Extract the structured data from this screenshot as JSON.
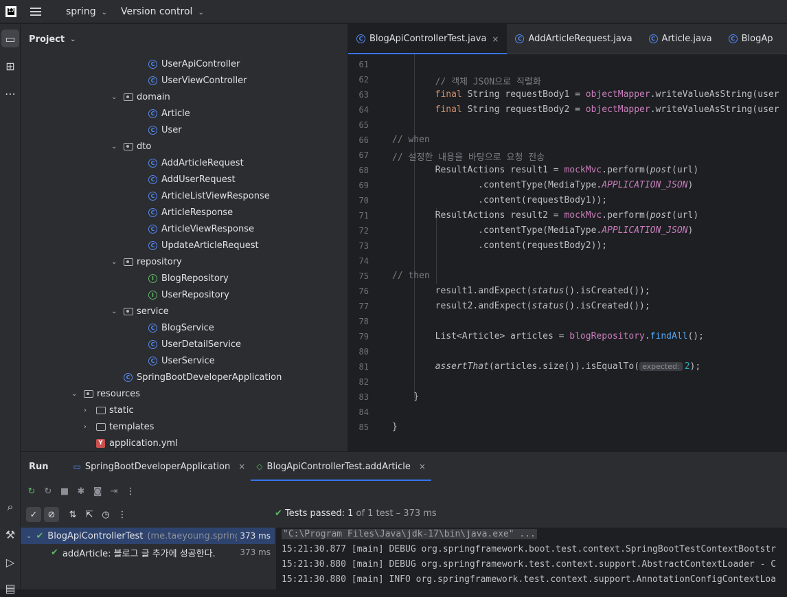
{
  "topbar": {
    "project": "spring",
    "vcs": "Version control"
  },
  "project_panel": {
    "title": "Project",
    "rows": [
      {
        "label": "UserApiController",
        "icon": "class",
        "depth": 3
      },
      {
        "label": "UserViewController",
        "icon": "class",
        "depth": 3
      },
      {
        "label": "domain",
        "icon": "package",
        "depth": 2,
        "expanded": true
      },
      {
        "label": "Article",
        "icon": "class",
        "depth": 3
      },
      {
        "label": "User",
        "icon": "class",
        "depth": 3
      },
      {
        "label": "dto",
        "icon": "package",
        "depth": 2,
        "expanded": true
      },
      {
        "label": "AddArticleRequest",
        "icon": "class",
        "depth": 3
      },
      {
        "label": "AddUserRequest",
        "icon": "class",
        "depth": 3
      },
      {
        "label": "ArticleListViewResponse",
        "icon": "class",
        "depth": 3
      },
      {
        "label": "ArticleResponse",
        "icon": "class",
        "depth": 3
      },
      {
        "label": "ArticleViewResponse",
        "icon": "class",
        "depth": 3
      },
      {
        "label": "UpdateArticleRequest",
        "icon": "class",
        "depth": 3
      },
      {
        "label": "repository",
        "icon": "package",
        "depth": 2,
        "expanded": true
      },
      {
        "label": "BlogRepository",
        "icon": "interface",
        "depth": 3
      },
      {
        "label": "UserRepository",
        "icon": "interface",
        "depth": 3
      },
      {
        "label": "service",
        "icon": "package",
        "depth": 2,
        "expanded": true
      },
      {
        "label": "BlogService",
        "icon": "class",
        "depth": 3
      },
      {
        "label": "UserDetailService",
        "icon": "class",
        "depth": 3
      },
      {
        "label": "UserService",
        "icon": "class",
        "depth": 3
      },
      {
        "label": "SpringBootDeveloperApplication",
        "icon": "class",
        "depth": 2
      },
      {
        "label": "resources",
        "icon": "package",
        "depth": 0,
        "expanded": true
      },
      {
        "label": "static",
        "icon": "folder",
        "depth": 1,
        "expanded": false
      },
      {
        "label": "templates",
        "icon": "folder",
        "depth": 1,
        "expanded": false
      },
      {
        "label": "application.yml",
        "icon": "yaml",
        "depth": 1
      }
    ]
  },
  "editor": {
    "tabs": [
      {
        "label": "BlogApiControllerTest.java",
        "active": true
      },
      {
        "label": "AddArticleRequest.java",
        "active": false
      },
      {
        "label": "Article.java",
        "active": false
      },
      {
        "label": "BlogAp",
        "active": false
      }
    ],
    "lines": [
      {
        "n": "61",
        "t": ""
      },
      {
        "n": "62",
        "t": "        // 객체 JSON으로 직렬화"
      },
      {
        "n": "63",
        "t": "        final String requestBody1 = objectMapper.writeValueAsString(user"
      },
      {
        "n": "64",
        "t": "        final String requestBody2 = objectMapper.writeValueAsString(user"
      },
      {
        "n": "65",
        "t": ""
      },
      {
        "n": "66",
        "t": "// when"
      },
      {
        "n": "67",
        "t": "// 설정한 내용을 바탕으로 요청 전송"
      },
      {
        "n": "68",
        "t": "        ResultActions result1 = mockMvc.perform(post(url)"
      },
      {
        "n": "69",
        "t": "                .contentType(MediaType.APPLICATION_JSON)"
      },
      {
        "n": "70",
        "t": "                .content(requestBody1));"
      },
      {
        "n": "71",
        "t": "        ResultActions result2 = mockMvc.perform(post(url)"
      },
      {
        "n": "72",
        "t": "                .contentType(MediaType.APPLICATION_JSON)"
      },
      {
        "n": "73",
        "t": "                .content(requestBody2));"
      },
      {
        "n": "74",
        "t": ""
      },
      {
        "n": "75",
        "t": "// then"
      },
      {
        "n": "76",
        "t": "        result1.andExpect(status().isCreated());"
      },
      {
        "n": "77",
        "t": "        result2.andExpect(status().isCreated());"
      },
      {
        "n": "78",
        "t": ""
      },
      {
        "n": "79",
        "t": "        List<Article> articles = blogRepository.findAll();"
      },
      {
        "n": "80",
        "t": ""
      },
      {
        "n": "81",
        "t": "        assertThat(articles.size()).isEqualTo(expected: 2);"
      },
      {
        "n": "82",
        "t": ""
      },
      {
        "n": "83",
        "t": "    }"
      },
      {
        "n": "84",
        "t": ""
      },
      {
        "n": "85",
        "t": "}"
      }
    ]
  },
  "run_panel": {
    "title": "Run",
    "tabs": [
      {
        "label": "SpringBootDeveloperApplication",
        "active": false
      },
      {
        "label": "BlogApiControllerTest.addArticle",
        "active": true
      }
    ],
    "status_prefix": "Tests passed:",
    "status_count": "1",
    "status_rest": "of 1 test – 373 ms",
    "tests": [
      {
        "label": "BlogApiControllerTest",
        "sub": "(me.taeyoung.springb",
        "time": "373 ms"
      },
      {
        "label": "addArticle: 블로그 글 추가에 성공한다.",
        "sub": "",
        "time": "373 ms"
      }
    ],
    "console": [
      "\"C:\\Program Files\\Java\\jdk-17\\bin\\java.exe\" ...",
      "15:21:30.877 [main] DEBUG org.springframework.boot.test.context.SpringBootTestContextBootstr",
      "15:21:30.880 [main] DEBUG org.springframework.test.context.support.AbstractContextLoader - C",
      "15:21:30.880 [main] INFO org.springframework.test.context.support.AnnotationConfigContextLoa"
    ]
  }
}
